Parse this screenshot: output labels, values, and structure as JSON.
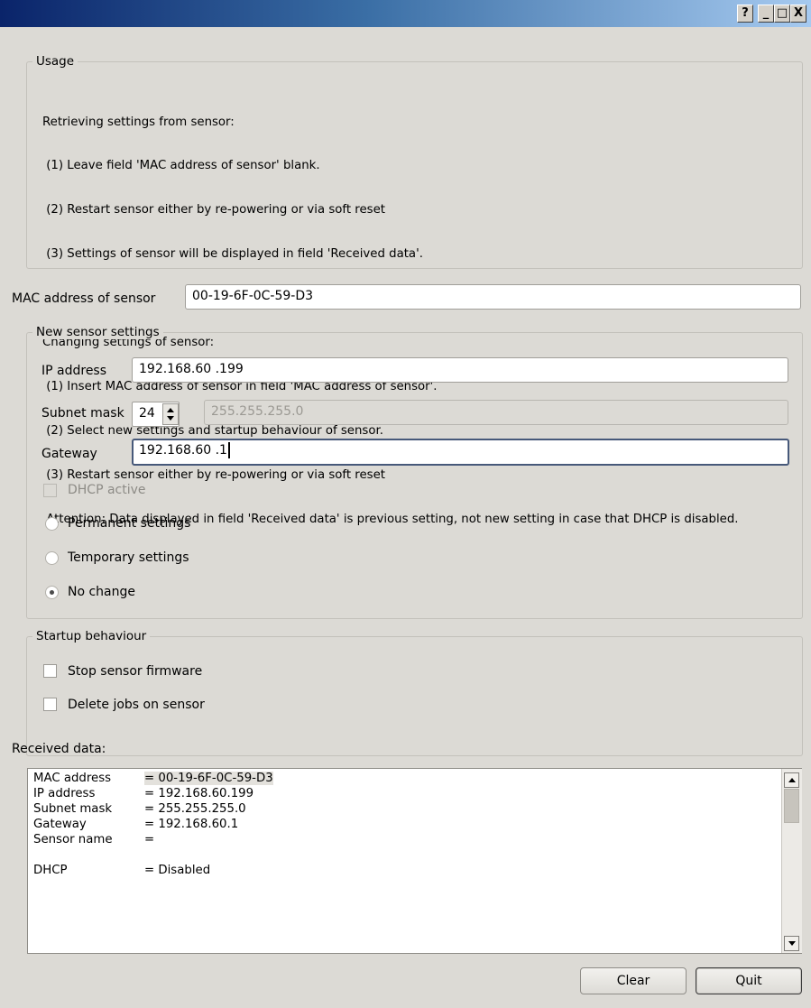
{
  "window": {
    "title": "",
    "caption_buttons": {
      "help": "?",
      "minimize": "_",
      "maximize": "□",
      "close": "X"
    }
  },
  "usage": {
    "legend": "Usage",
    "retrieve_heading": "Retrieving settings from sensor:",
    "retrieve_steps": [
      " (1) Leave field 'MAC address of sensor' blank.",
      " (2) Restart sensor either by re-powering or via soft reset",
      " (3) Settings of sensor will be displayed in field 'Received data'."
    ],
    "change_heading": "Changing settings of sensor:",
    "change_steps": [
      " (1) Insert MAC address of sensor in field 'MAC address of sensor'.",
      " (2) Select new settings and startup behaviour of sensor.",
      " (3) Restart sensor either by re-powering or via soft reset"
    ],
    "attention": " Attention: Data displayed in field 'Received data' is previous setting, not new setting in case that DHCP is disabled."
  },
  "mac": {
    "label": "MAC address of sensor",
    "value": "00-19-6F-0C-59-D3"
  },
  "new_settings": {
    "legend": "New sensor settings",
    "ip_label": "IP address",
    "ip_value": "192.168.60 .199",
    "subnet_label": "Subnet mask",
    "subnet_prefix": "24",
    "subnet_value": "255.255.255.0",
    "gateway_label": "Gateway",
    "gateway_value": "192.168.60 .1",
    "dhcp_label": "DHCP active",
    "dhcp_checked": false,
    "options": [
      {
        "label": "Permanent settings",
        "checked": false
      },
      {
        "label": "Temporary settings",
        "checked": false
      },
      {
        "label": "No change",
        "checked": true
      }
    ]
  },
  "startup": {
    "legend": "Startup behaviour",
    "stop_firmware_label": "Stop sensor firmware",
    "stop_firmware_checked": false,
    "delete_jobs_label": "Delete jobs on sensor",
    "delete_jobs_checked": false
  },
  "received": {
    "label": "Received data:",
    "rows": [
      {
        "key": "MAC address",
        "value": "= 00-19-6F-0C-59-D3"
      },
      {
        "key": "IP address",
        "value": "= 192.168.60.199"
      },
      {
        "key": "Subnet mask",
        "value": "= 255.255.255.0"
      },
      {
        "key": "Gateway",
        "value": "= 192.168.60.1"
      },
      {
        "key": "Sensor name",
        "value": "="
      },
      {
        "key": "",
        "value": ""
      },
      {
        "key": "DHCP",
        "value": "= Disabled"
      }
    ]
  },
  "buttons": {
    "clear": "Clear",
    "quit": "Quit"
  },
  "colors": {
    "titlebar_start": "#0a246a",
    "titlebar_end": "#a6caf0",
    "window_bg": "#dcdad5"
  }
}
